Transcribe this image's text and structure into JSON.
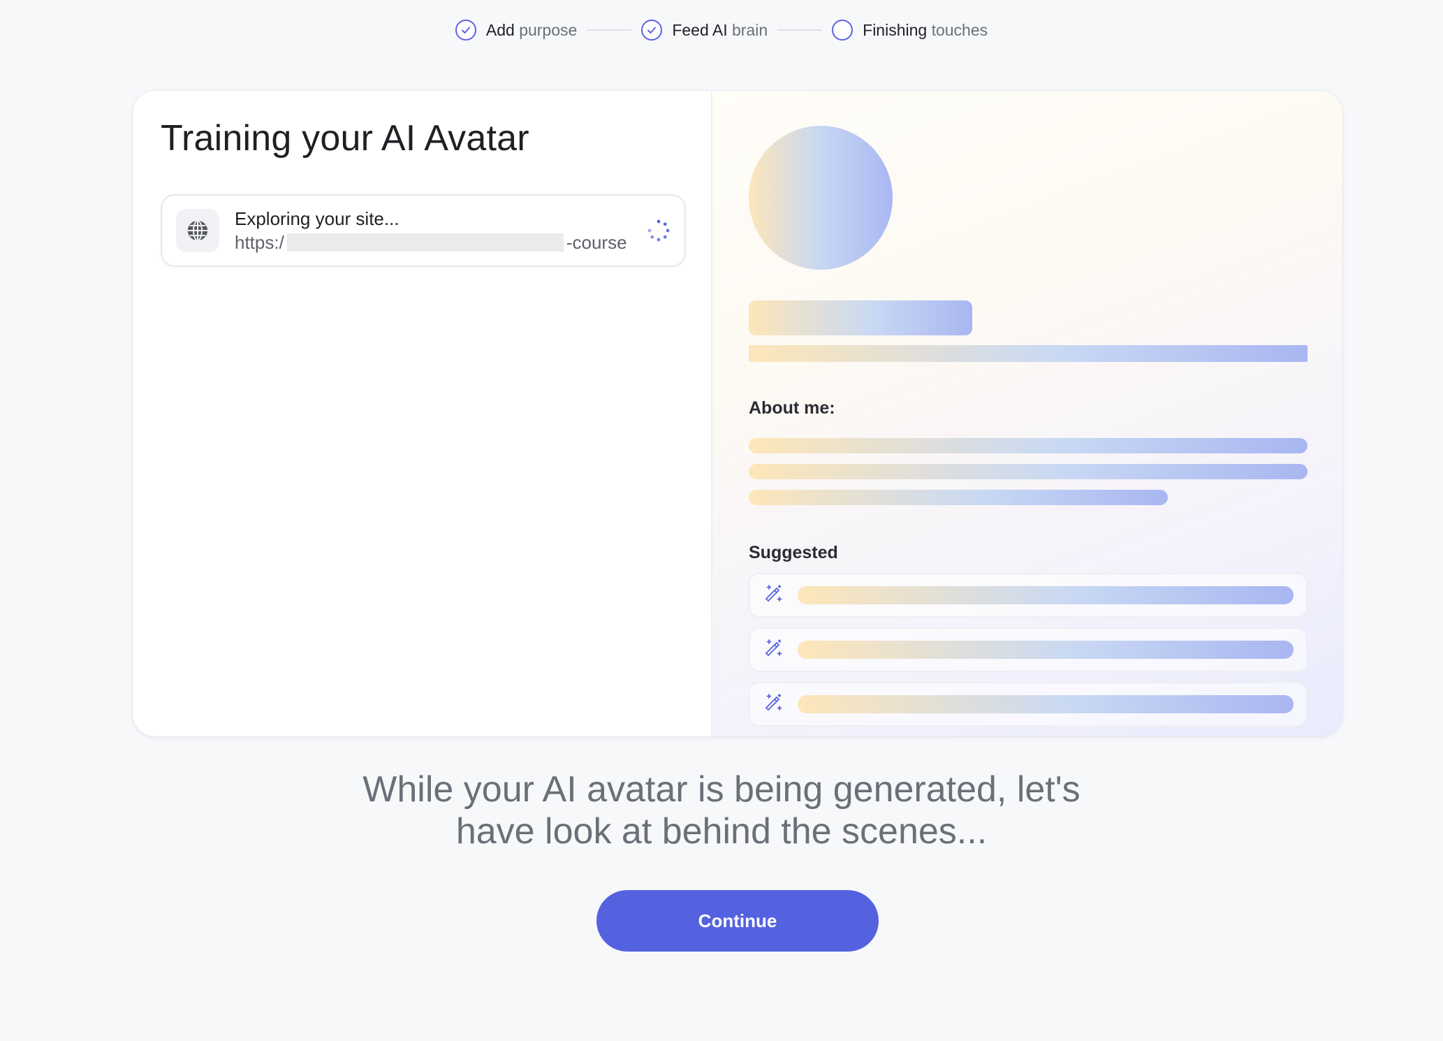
{
  "stepper": {
    "steps": [
      {
        "strong": "Add",
        "light": "purpose",
        "state": "complete",
        "icon": "check-icon"
      },
      {
        "strong": "Feed AI",
        "light": "brain",
        "state": "complete",
        "icon": "check-icon"
      },
      {
        "strong": "Finishing",
        "light": "touches",
        "state": "pending",
        "icon": "empty-circle-icon"
      }
    ]
  },
  "training": {
    "title": "Training your AI Avatar",
    "site_item": {
      "status": "Exploring your site...",
      "url_prefix": "https:/",
      "url_suffix": "-course",
      "icon": "globe-icon",
      "loading_icon": "spinner-icon"
    }
  },
  "preview": {
    "about_label": "About me:",
    "suggested_label": "Suggested",
    "suggestion_icon": "magic-wand-icon"
  },
  "footer": {
    "tagline_part1": "While your AI avatar is being generated, let's",
    "tagline_part2": "have look at behind the scenes...",
    "continue_label": "Continue"
  },
  "colors": {
    "accent": "#5462e0",
    "gradient_start": "#fde6b9",
    "gradient_end": "#a9b6f2"
  }
}
